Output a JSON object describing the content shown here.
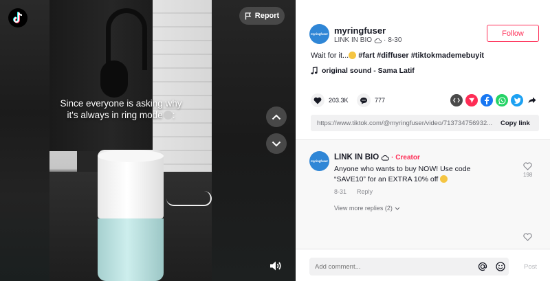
{
  "video": {
    "caption": "Since everyone is asking why it's always in ring mode",
    "caption_emoji": "skull",
    "report_label": "Report"
  },
  "author": {
    "avatar_text": "myringfuser",
    "username": "myringfuser",
    "nickname": "LINK IN BIO",
    "date": "8-30"
  },
  "follow_label": "Follow",
  "description": {
    "text": "Wait for it...",
    "tags": "#fart #diffuser #tiktokmademebuyit"
  },
  "music": "original sound - Sama Latif",
  "stats": {
    "likes": "203.3K",
    "comments": "777"
  },
  "share_icons": [
    "embed-icon",
    "send-icon",
    "facebook-icon",
    "whatsapp-icon",
    "twitter-icon",
    "share-arrow-icon"
  ],
  "link": {
    "url": "https://www.tiktok.com/@myringfuser/video/713734756932...",
    "copy_label": "Copy link"
  },
  "comment": {
    "name": "LINK IN BIO",
    "badge": "· Creator",
    "text": "Anyone who wants to buy NOW! Use code “SAVE10” for an EXTRA 10% off",
    "date": "8-31",
    "reply_label": "Reply",
    "view_more": "View more replies (2)",
    "likes": "198"
  },
  "input": {
    "placeholder": "Add comment...",
    "post_label": "Post"
  },
  "colors": {
    "brand": "#fe2c55",
    "avatar": "#2f86d6"
  }
}
